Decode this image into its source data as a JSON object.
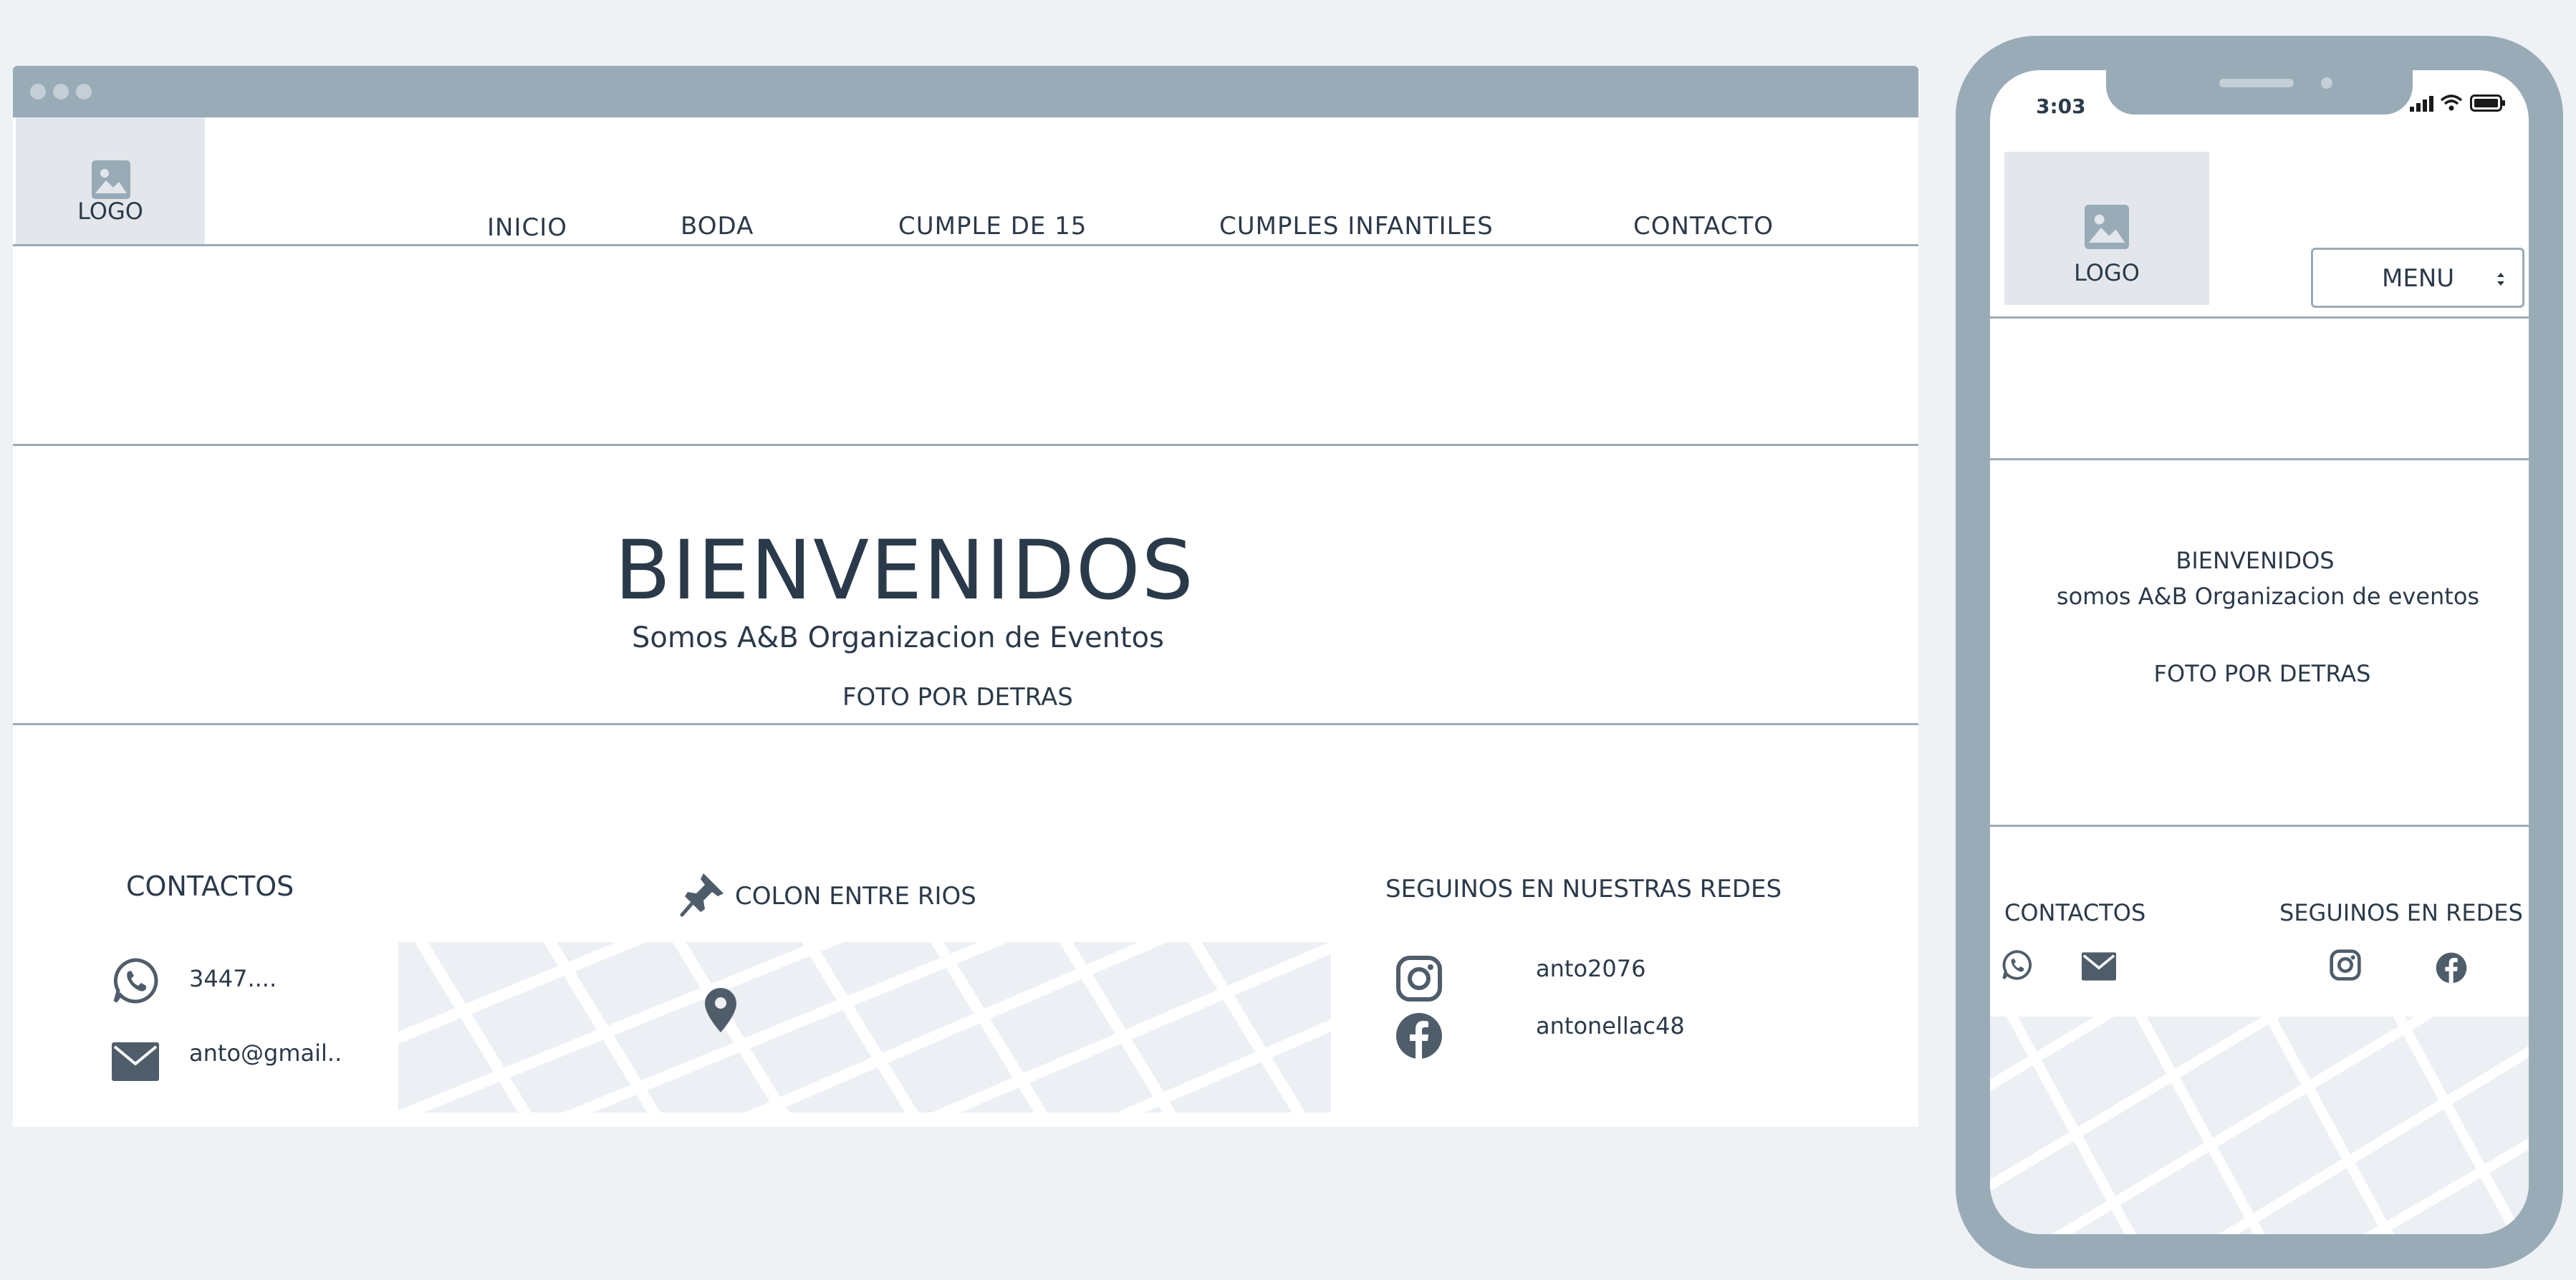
{
  "desktop": {
    "logo_label": "LOGO",
    "nav": [
      "INICIO",
      "BODA",
      "CUMPLE DE 15",
      "CUMPLES INFANTILES",
      "CONTACTO"
    ],
    "hero": {
      "title": "BIENVENIDOS",
      "subtitle": "Somos A&B Organizacion de Eventos",
      "note": "FOTO POR DETRAS"
    },
    "footer": {
      "contacts_title": "CONTACTOS",
      "phone": "3447....",
      "email": "anto@gmail..",
      "location": "COLON ENTRE RIOS",
      "social_title": "SEGUINOS EN NUESTRAS REDES",
      "instagram": "anto2076",
      "facebook": "antonellac48"
    }
  },
  "mobile": {
    "time": "3:03",
    "logo_label": "LOGO",
    "menu_label": "MENU",
    "hero_title": "BIENVENIDOS",
    "hero_subtitle": "somos A&B Organizacion de eventos",
    "hero_note": "FOTO POR DETRAS",
    "contacts_title": "CONTACTOS",
    "social_title": "SEGUINOS EN REDES"
  },
  "colors": {
    "frame": "#9aabb8",
    "text": "#2b3a4a",
    "icon": "#4f5d6b",
    "placeholder": "#e3e7eb",
    "background": "#eff2f5"
  }
}
